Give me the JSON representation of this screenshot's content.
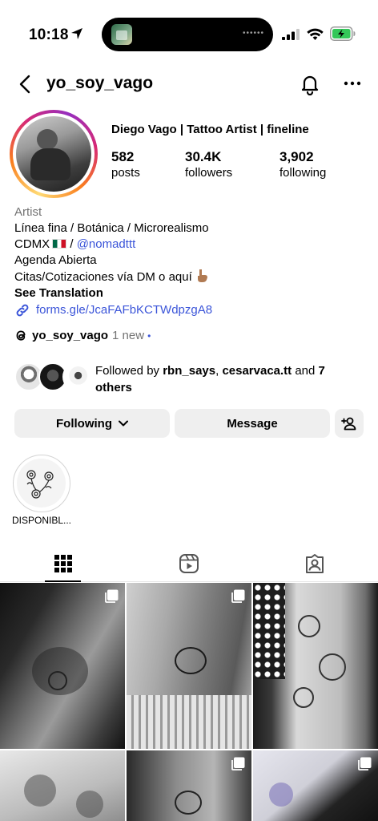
{
  "status_bar": {
    "time": "10:18",
    "island_dots": "••••••"
  },
  "header": {
    "username": "yo_soy_vago"
  },
  "profile": {
    "full_name": "Diego Vago | Tattoo Artist | fineline",
    "stats": [
      {
        "value": "582",
        "label": "posts"
      },
      {
        "value": "30.4K",
        "label": "followers"
      },
      {
        "value": "3,902",
        "label": "following"
      }
    ]
  },
  "bio": {
    "category": "Artist",
    "line1": "Línea fina / Botánica / Microrealismo",
    "line2_prefix": "CDMX",
    "line2_sep": "/",
    "line2_mention": "@nomadttt",
    "line3": "Agenda Abierta",
    "line4": "Citas/Cotizaciones vía DM o aquí",
    "see_translation": "See Translation",
    "link": "forms.gle/JcaFAFbKCTWdpzgA8"
  },
  "threads": {
    "name": "yo_soy_vago",
    "new_label": "1 new",
    "dot": "•"
  },
  "followed_by": {
    "prefix": "Followed by",
    "user1": "rbn_says",
    "sep": ",",
    "user2": "cesarvaca.tt",
    "and": "and",
    "others": "7 others"
  },
  "buttons": {
    "following": "Following",
    "message": "Message"
  },
  "highlights": [
    {
      "label": "DISPONIBL..."
    }
  ],
  "icons": {
    "back": "chevron-left-icon",
    "bell": "bell-icon",
    "more": "more-horizontal-icon",
    "link": "link-icon",
    "threads": "threads-logo-icon",
    "add_user": "add-user-icon",
    "grid": "grid-icon",
    "reels": "reels-icon",
    "tagged": "tagged-icon",
    "multi": "carousel-icon"
  },
  "colors": {
    "link": "#3b55d9",
    "secondary_text": "#737373",
    "button_bg": "#efefef",
    "battery_fill": "#34c759"
  }
}
